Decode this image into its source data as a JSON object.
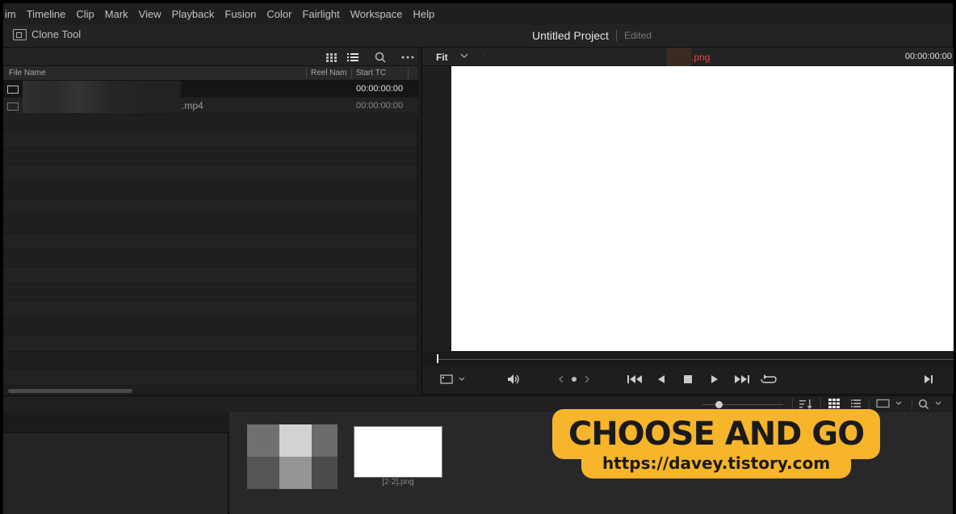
{
  "menu": [
    "im",
    "Timeline",
    "Clip",
    "Mark",
    "View",
    "Playback",
    "Fusion",
    "Color",
    "Fairlight",
    "Workspace",
    "Help"
  ],
  "toolbar": {
    "clone_tool_label": "Clone Tool",
    "project_title": "Untitled Project",
    "project_status": "Edited"
  },
  "media_pool": {
    "columns": {
      "file_name": "File Name",
      "reel_name": "Reel Nam",
      "start_tc": "Start TC"
    },
    "rows": [
      {
        "name": "",
        "start_tc": "00:00:00:00"
      },
      {
        "name": ".mp4",
        "start_tc": "00:00:00:00"
      }
    ]
  },
  "viewer": {
    "zoom_label": "Fit",
    "filename": ".png",
    "timecode": "00:00:00:00"
  },
  "thumbnails": {
    "second_label": "[2-2].png"
  },
  "banner": {
    "main": "CHOOSE AND GO",
    "url": "https://davey.tistory.com"
  },
  "colors": {
    "accent_filename": "#e14a3a",
    "banner": "#f6b52a",
    "mosaic": [
      "#707070",
      "#d2d2d2",
      "#6b6b6b",
      "#555555",
      "#959595",
      "#4b4b4b"
    ]
  }
}
